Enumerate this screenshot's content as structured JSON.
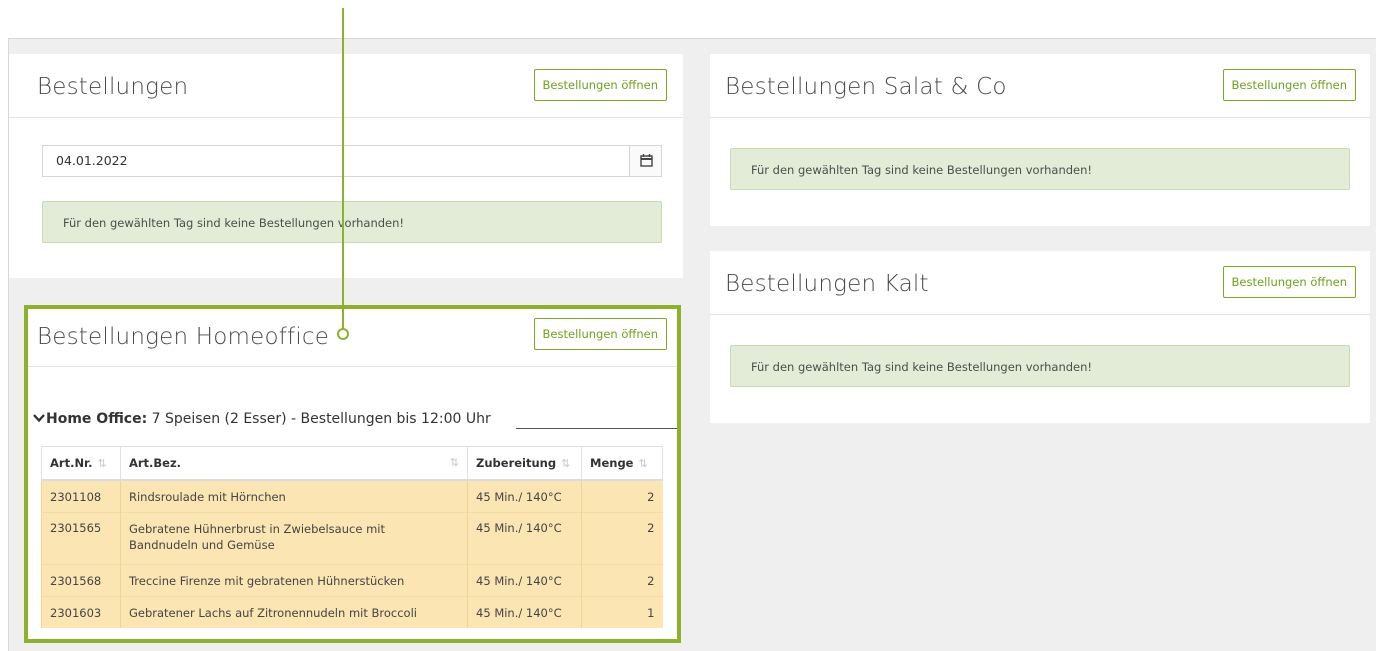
{
  "panels": {
    "bestellungen": {
      "title": "Bestellungen",
      "button": "Bestellungen öffnen",
      "date": "04.01.2022",
      "message": "Für den gewählten Tag sind keine Bestellungen vorhanden!"
    },
    "salat": {
      "title": "Bestellungen Salat & Co",
      "button": "Bestellungen öffnen",
      "message": "Für den gewählten Tag sind keine Bestellungen vorhanden!"
    },
    "kalt": {
      "title": "Bestellungen Kalt",
      "button": "Bestellungen öffnen",
      "message": "Für den gewählten Tag sind keine Bestellungen vorhanden!"
    },
    "homeoffice": {
      "title": "Bestellungen Homeoffice",
      "button": "Bestellungen öffnen",
      "group_label": "Home Office:",
      "group_summary": " 7 Speisen (2 Esser) - Bestellungen bis 12:00 Uhr",
      "columns": [
        "Art.Nr.",
        "Art.Bez.",
        "Zubereitung",
        "Menge"
      ],
      "rows": [
        {
          "artnr": "2301108",
          "bez": "Rindsroulade mit Hörnchen",
          "zub": "45 Min./ 140°C",
          "menge": "2"
        },
        {
          "artnr": "2301565",
          "bez": "Gebratene Hühnerbrust in Zwiebelsauce mit Bandnudeln und Gemüse",
          "zub": "45 Min./ 140°C",
          "menge": "2"
        },
        {
          "artnr": "2301568",
          "bez": "Treccine Firenze mit gebratenen Hühnerstücken",
          "zub": "45 Min./ 140°C",
          "menge": "2"
        },
        {
          "artnr": "2301603",
          "bez": "Gebratener Lachs auf Zitronennudeln mit Broccoli",
          "zub": "45 Min./ 140°C",
          "menge": "1"
        }
      ]
    }
  },
  "icons": {
    "calendar": "calendar-icon",
    "chevron": "chevron-down-icon",
    "sort": "sort-icon"
  },
  "colors": {
    "accent": "#8cb22a",
    "alert_bg": "#e3ecd6",
    "row_bg": "#fbe5b3"
  }
}
